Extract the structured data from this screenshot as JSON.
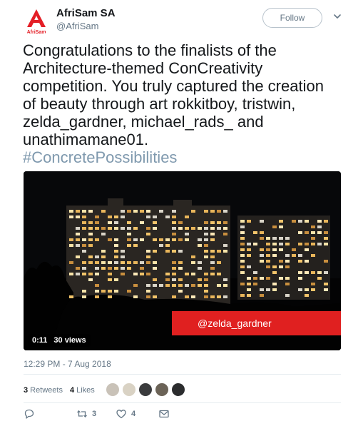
{
  "account": {
    "display_name": "AfriSam SA",
    "handle": "@AfriSam",
    "logo_text": "AfriSam",
    "logo_color": "#e41e26"
  },
  "header": {
    "follow_label": "Follow"
  },
  "tweet": {
    "text": "Congratulations to the finalists of the Architecture-themed ConCreativity competition. You truly captured the creation of beauty through art rokkitboy, tristwin, zelda_gardner, michael_rads_ and unathimamane01.",
    "hashtag": "#ConcretePossibilities",
    "hashtag_color": "#7f99ae"
  },
  "media": {
    "caption": "@zelda_gardner",
    "caption_color": "#e02020",
    "duration": "0:11",
    "views": "30 views"
  },
  "timestamp": "12:29 PM - 7 Aug 2018",
  "stats": {
    "retweets_count": "3",
    "retweets_label": "Retweets",
    "likes_count": "4",
    "likes_label": "Likes"
  },
  "actions": {
    "reply_icon": "reply-icon",
    "retweet_icon": "retweet-icon",
    "retweet_count": "3",
    "like_icon": "heart-icon",
    "like_count": "4",
    "message_icon": "envelope-icon"
  }
}
